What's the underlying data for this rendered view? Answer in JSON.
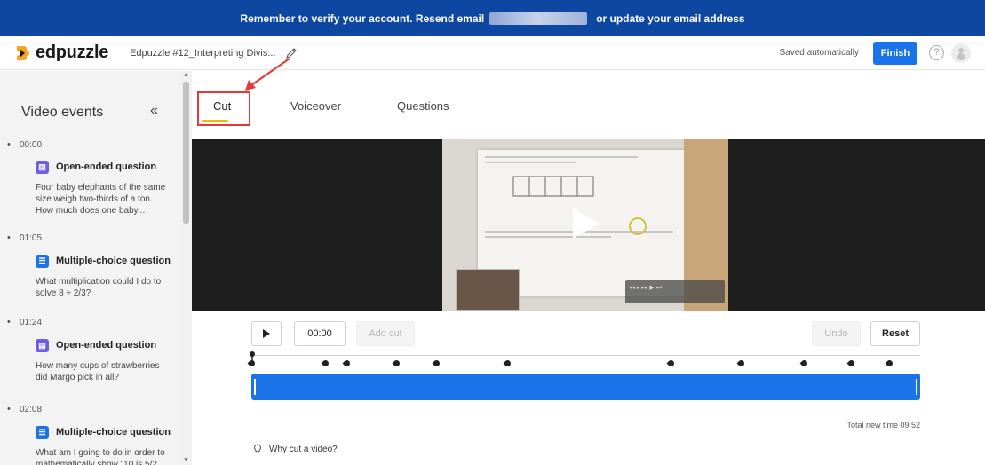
{
  "banner": {
    "text": "Remember to verify your account. Resend email",
    "link_text": "or  update your email address"
  },
  "header": {
    "logo": "edpuzzle",
    "doc_title": "Edpuzzle #12_Interpreting Divis...",
    "saved_status": "Saved automatically",
    "finish_label": "Finish",
    "help_glyph": "?"
  },
  "sidebar": {
    "title": "Video events",
    "collapse_glyph": "«",
    "events": [
      {
        "time": "00:00",
        "type": "Open-ended question",
        "desc": "Four baby elephants of the same size weigh two-thirds of a ton. How much does one baby..."
      },
      {
        "time": "01:05",
        "type": "Multiple-choice question",
        "desc": "What multiplication could I do to solve 8 ÷ 2/3?"
      },
      {
        "time": "01:24",
        "type": "Open-ended question",
        "desc": "How many cups of strawberries did Margo pick in all?"
      },
      {
        "time": "02:08",
        "type": "Multiple-choice question",
        "desc": "What am I going to do in order to mathematically show \"10 is 5/2..."
      }
    ]
  },
  "tabs": [
    "Cut",
    "Voiceover",
    "Questions"
  ],
  "controls": {
    "time": "00:00",
    "add_cut": "Add cut",
    "undo": "Undo",
    "reset": "Reset"
  },
  "timeline": {
    "marker_count": 14
  },
  "footer": {
    "total_time": "Total new time 09:52",
    "why": "Why cut a video?"
  },
  "colors": {
    "banner": "#0d47a1",
    "accent": "#1a73e8",
    "tab_underline": "#f2b705",
    "annotation": "#e53935",
    "open_icon": "#6c5ce7"
  }
}
